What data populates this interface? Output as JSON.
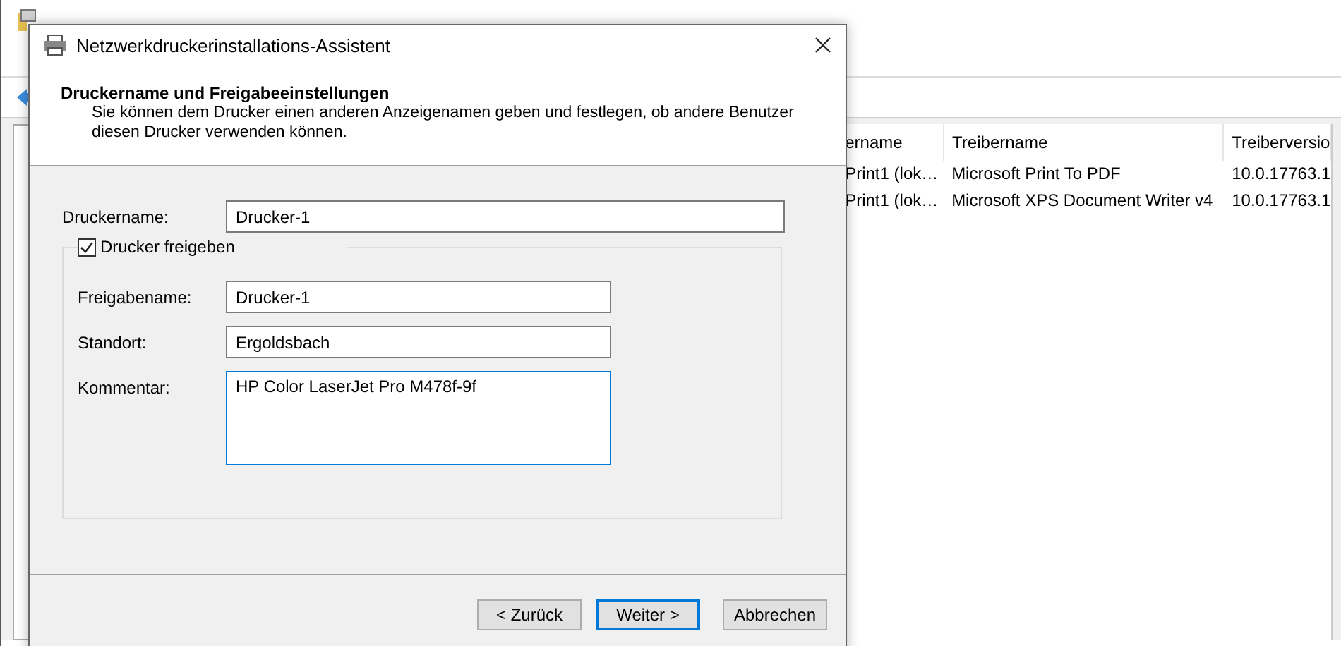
{
  "background_window": {
    "list": {
      "columns": [
        "ername",
        "Treibername",
        "Treiberversio"
      ],
      "rows": [
        [
          "Print1 (lok…",
          "Microsoft Print To PDF",
          "10.0.17763.1"
        ],
        [
          "Print1 (lok…",
          "Microsoft XPS Document Writer v4",
          "10.0.17763.1"
        ]
      ]
    }
  },
  "dialog": {
    "title": "Netzwerkdruckerinstallations-Assistent",
    "header": {
      "heading": "Druckername und Freigabeeinstellungen",
      "description": "Sie können dem Drucker einen anderen Anzeigenamen geben und festlegen, ob andere Benutzer diesen Drucker verwenden können."
    },
    "name_field": {
      "label": "Druckername:",
      "value": "Drucker-1"
    },
    "share": {
      "label": "Drucker freigeben",
      "checked": true,
      "fields": [
        {
          "label": "Freigabename:",
          "value": "Drucker-1",
          "kind": "line",
          "focused": false
        },
        {
          "label": "Standort:",
          "value": "Ergoldsbach",
          "kind": "line",
          "focused": false
        },
        {
          "label": "Kommentar:",
          "value": "HP Color LaserJet Pro M478f-9f",
          "kind": "multiline",
          "focused": true
        }
      ]
    },
    "buttons": [
      {
        "label": "< Zurück",
        "default": false
      },
      {
        "label": "Weiter >",
        "default": true
      },
      {
        "label": "Abbrechen",
        "default": false
      }
    ]
  }
}
